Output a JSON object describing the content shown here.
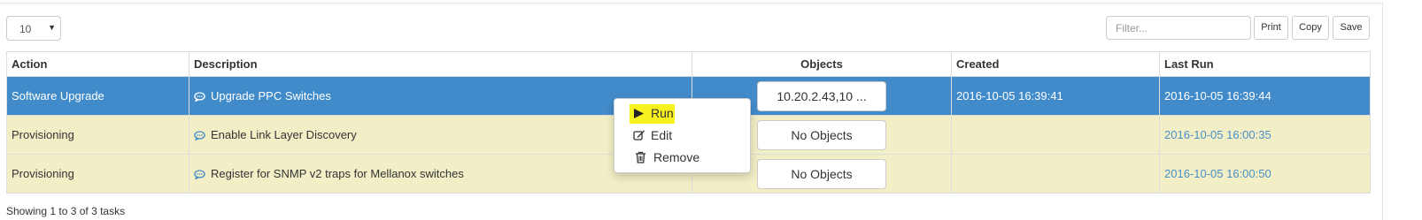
{
  "toolbar": {
    "page_size": "10",
    "filter_placeholder": "Filter...",
    "print_label": "Print",
    "copy_label": "Copy",
    "save_label": "Save"
  },
  "table": {
    "headers": {
      "action": "Action",
      "description": "Description",
      "objects": "Objects",
      "created": "Created",
      "last_run": "Last Run"
    },
    "rows": [
      {
        "action": "Software Upgrade",
        "description": "Upgrade PPC Switches",
        "objects": "10.20.2.43,10 ...",
        "created": "2016-10-05 16:39:41",
        "last_run": "2016-10-05 16:39:44"
      },
      {
        "action": "Provisioning",
        "description": "Enable Link Layer Discovery",
        "objects": "No Objects",
        "created": "",
        "last_run": "2016-10-05 16:00:35"
      },
      {
        "action": "Provisioning",
        "description": "Register for SNMP v2 traps for Mellanox switches",
        "objects": "No Objects",
        "created": "",
        "last_run": "2016-10-05 16:00:50"
      }
    ]
  },
  "context_menu": {
    "run": "Run",
    "edit": "Edit",
    "remove": "Remove",
    "run_highlight_color": "#f7f11f"
  },
  "footer": {
    "info": "Showing 1 to 3 of 3 tasks"
  },
  "icons": {
    "page_size_caret": "caret-down-icon",
    "description": "comment-icon",
    "run": "play-icon",
    "edit": "edit-icon",
    "remove": "trash-icon"
  },
  "colors": {
    "selected_row": "#428bca",
    "row_background": "#f2eec6",
    "last_run_link": "#4a90c8"
  }
}
